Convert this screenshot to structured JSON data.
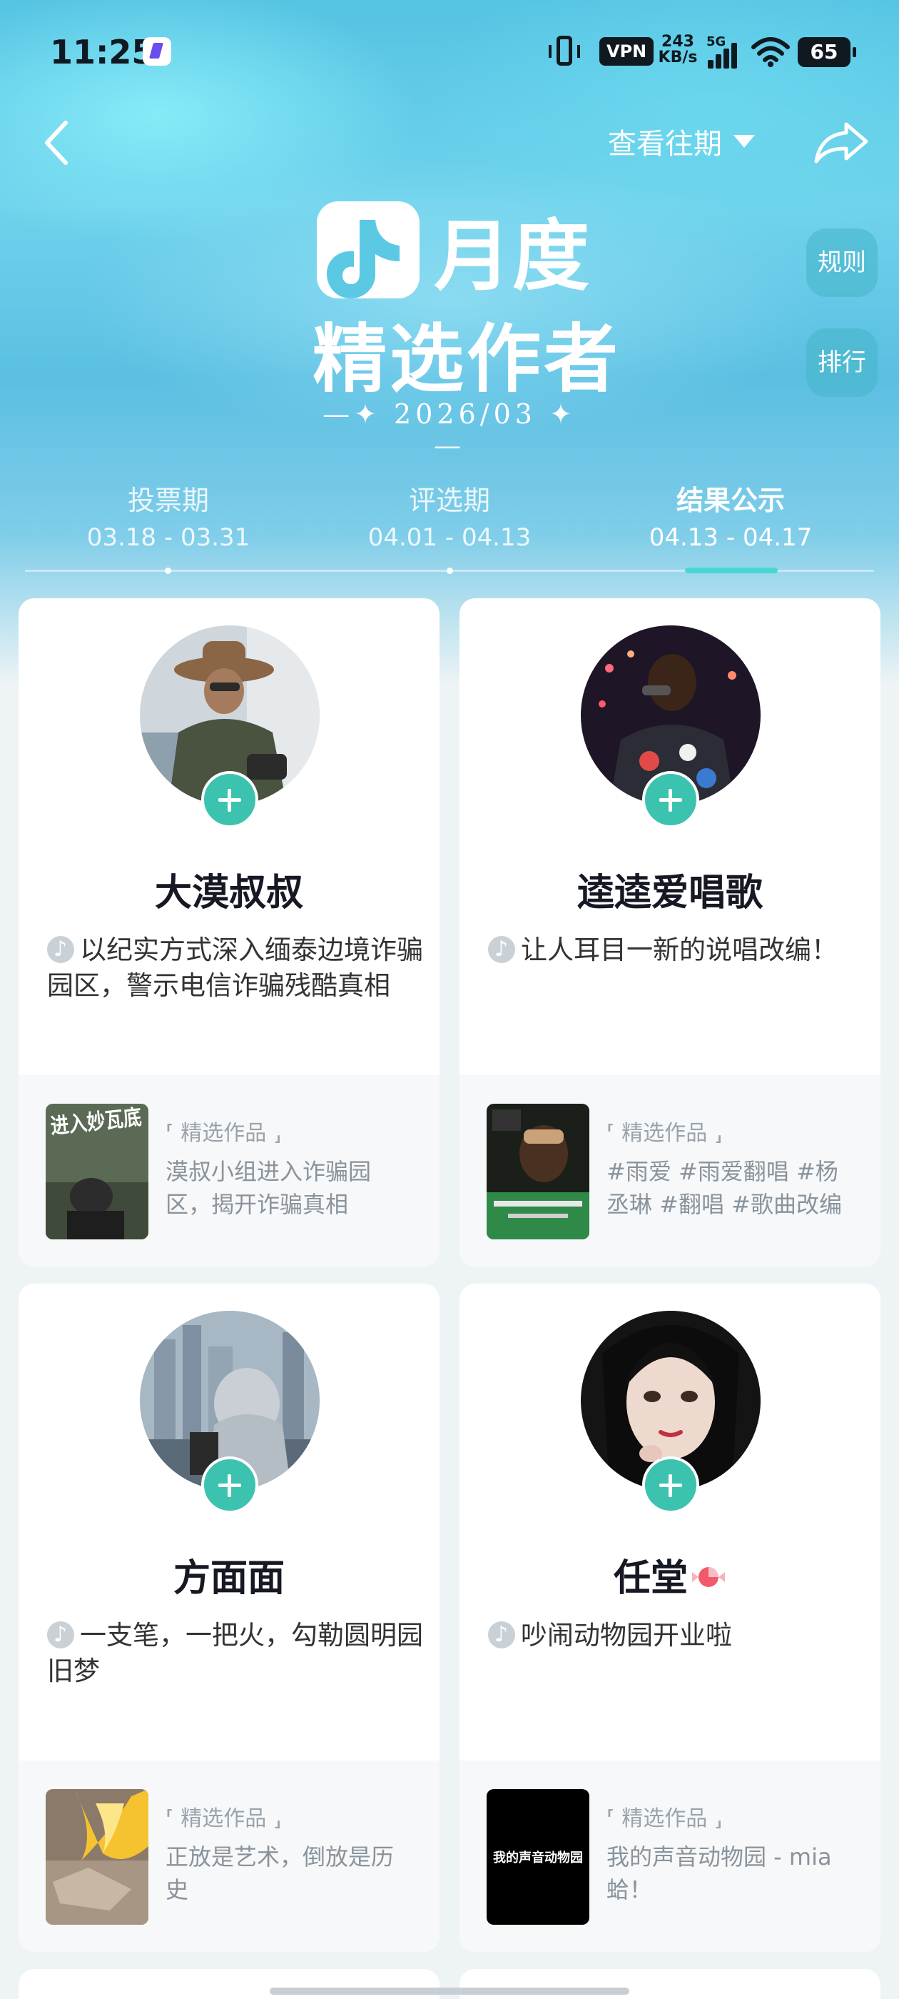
{
  "status_bar": {
    "time": "11:25",
    "vpn": "VPN",
    "netspeed_value": "243",
    "netspeed_unit": "KB/s",
    "signal_label": "5G",
    "battery": "65"
  },
  "header": {
    "history_label": "查看往期",
    "title_line1": "月度",
    "title_line2": "精选作者",
    "period": "—✦ 2026/03 ✦—",
    "rules_label": "规则",
    "rank_label": "排行"
  },
  "timeline": {
    "phases": [
      {
        "name": "投票期",
        "dates": "03.18 - 03.31"
      },
      {
        "name": "评选期",
        "dates": "04.01 - 04.13"
      },
      {
        "name": "结果公示",
        "dates": "04.13 - 04.17"
      }
    ],
    "active_index": 2
  },
  "cards": [
    {
      "name": "大漠叔叔",
      "desc": "以纪实方式深入缅泰边境诈骗园区，警示电信诈骗残酷真相",
      "works_title": "⸢ 精选作品 ⸥",
      "works_desc": "漠叔小组进入诈骗园区，揭开诈骗真相",
      "thumb_text": "进入妙瓦底"
    },
    {
      "name": "逵逵爱唱歌",
      "desc": "让人耳目一新的说唱改编！",
      "works_title": "⸢ 精选作品 ⸥",
      "works_desc": "#雨爱 #雨爱翻唱 #杨丞琳 #翻唱 #歌曲改编"
    },
    {
      "name": "方面面",
      "desc": "一支笔，一把火，勾勒圆明园旧梦",
      "works_title": "⸢ 精选作品 ⸥",
      "works_desc": "正放是艺术，倒放是历史"
    },
    {
      "name": "任堂",
      "desc": "吵闹动物园开业啦",
      "works_title": "⸢ 精选作品 ⸥",
      "works_desc": "我的声音动物园 - mia蛤！",
      "thumb_text": "我的声音动物园"
    }
  ],
  "colors": {
    "accent": "#3bc3b0",
    "timeline_active": "#47d8d2",
    "page_bg": "#eef4f5"
  }
}
